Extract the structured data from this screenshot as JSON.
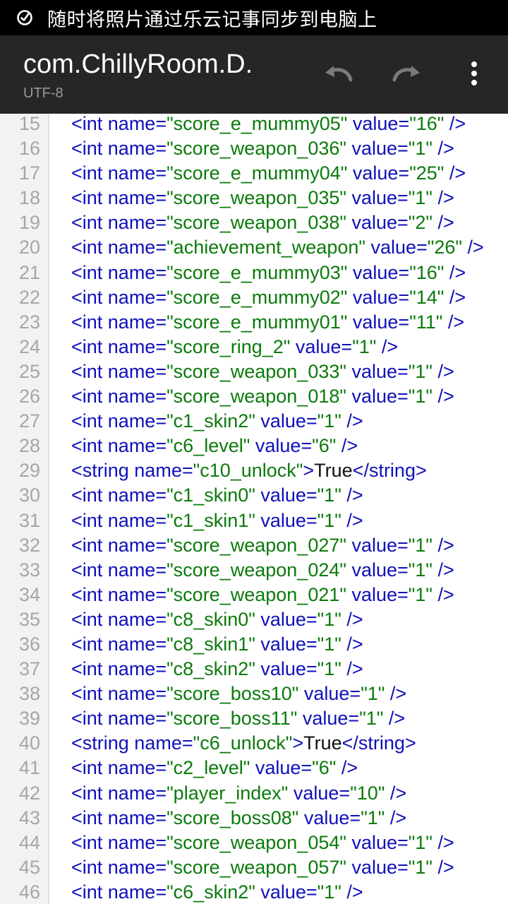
{
  "statusbar": {
    "text": "随时将照片通过乐云记事同步到电脑上",
    "icon": "note-sync-icon"
  },
  "appbar": {
    "title": "com.ChillyRoom.D.",
    "encoding": "UTF-8",
    "actions": [
      "undo-icon",
      "redo-icon",
      "more-vert-icon"
    ]
  },
  "colors": {
    "tag": "#1010bb",
    "value": "#0c7a0c",
    "text": "#111111",
    "line_number": "#a6a6a6",
    "gutter_bg": "#f2f2f2",
    "appbar_bg": "#262626"
  },
  "editor": {
    "lines": [
      {
        "num": "15",
        "parts": [
          {
            "t": "<int name=",
            "c": "tag"
          },
          {
            "t": "\"score_e_mummy05\"",
            "c": "value"
          },
          {
            "t": " value=",
            "c": "tag"
          },
          {
            "t": "\"16\"",
            "c": "value"
          },
          {
            "t": " />",
            "c": "tag"
          }
        ]
      },
      {
        "num": "16",
        "parts": [
          {
            "t": "<int name=",
            "c": "tag"
          },
          {
            "t": "\"score_weapon_036\"",
            "c": "value"
          },
          {
            "t": " value=",
            "c": "tag"
          },
          {
            "t": "\"1\"",
            "c": "value"
          },
          {
            "t": " />",
            "c": "tag"
          }
        ]
      },
      {
        "num": "17",
        "parts": [
          {
            "t": "<int name=",
            "c": "tag"
          },
          {
            "t": "\"score_e_mummy04\"",
            "c": "value"
          },
          {
            "t": " value=",
            "c": "tag"
          },
          {
            "t": "\"25\"",
            "c": "value"
          },
          {
            "t": " />",
            "c": "tag"
          }
        ]
      },
      {
        "num": "18",
        "parts": [
          {
            "t": "<int name=",
            "c": "tag"
          },
          {
            "t": "\"score_weapon_035\"",
            "c": "value"
          },
          {
            "t": " value=",
            "c": "tag"
          },
          {
            "t": "\"1\"",
            "c": "value"
          },
          {
            "t": " />",
            "c": "tag"
          }
        ]
      },
      {
        "num": "19",
        "parts": [
          {
            "t": "<int name=",
            "c": "tag"
          },
          {
            "t": "\"score_weapon_038\"",
            "c": "value"
          },
          {
            "t": " value=",
            "c": "tag"
          },
          {
            "t": "\"2\"",
            "c": "value"
          },
          {
            "t": " />",
            "c": "tag"
          }
        ]
      },
      {
        "num": "20",
        "parts": [
          {
            "t": "<int name=",
            "c": "tag"
          },
          {
            "t": "\"achievement_weapon\"",
            "c": "value"
          },
          {
            "t": " value=",
            "c": "tag"
          },
          {
            "t": "\"26\"",
            "c": "value"
          },
          {
            "t": " />",
            "c": "tag"
          }
        ]
      },
      {
        "num": "21",
        "parts": [
          {
            "t": "<int name=",
            "c": "tag"
          },
          {
            "t": "\"score_e_mummy03\"",
            "c": "value"
          },
          {
            "t": " value=",
            "c": "tag"
          },
          {
            "t": "\"16\"",
            "c": "value"
          },
          {
            "t": " />",
            "c": "tag"
          }
        ]
      },
      {
        "num": "22",
        "parts": [
          {
            "t": "<int name=",
            "c": "tag"
          },
          {
            "t": "\"score_e_mummy02\"",
            "c": "value"
          },
          {
            "t": " value=",
            "c": "tag"
          },
          {
            "t": "\"14\"",
            "c": "value"
          },
          {
            "t": " />",
            "c": "tag"
          }
        ]
      },
      {
        "num": "23",
        "parts": [
          {
            "t": "<int name=",
            "c": "tag"
          },
          {
            "t": "\"score_e_mummy01\"",
            "c": "value"
          },
          {
            "t": " value=",
            "c": "tag"
          },
          {
            "t": "\"11\"",
            "c": "value"
          },
          {
            "t": " />",
            "c": "tag"
          }
        ]
      },
      {
        "num": "24",
        "parts": [
          {
            "t": "<int name=",
            "c": "tag"
          },
          {
            "t": "\"score_ring_2\"",
            "c": "value"
          },
          {
            "t": " value=",
            "c": "tag"
          },
          {
            "t": "\"1\"",
            "c": "value"
          },
          {
            "t": " />",
            "c": "tag"
          }
        ]
      },
      {
        "num": "25",
        "parts": [
          {
            "t": "<int name=",
            "c": "tag"
          },
          {
            "t": "\"score_weapon_033\"",
            "c": "value"
          },
          {
            "t": " value=",
            "c": "tag"
          },
          {
            "t": "\"1\"",
            "c": "value"
          },
          {
            "t": " />",
            "c": "tag"
          }
        ]
      },
      {
        "num": "26",
        "parts": [
          {
            "t": "<int name=",
            "c": "tag"
          },
          {
            "t": "\"score_weapon_018\"",
            "c": "value"
          },
          {
            "t": " value=",
            "c": "tag"
          },
          {
            "t": "\"1\"",
            "c": "value"
          },
          {
            "t": " />",
            "c": "tag"
          }
        ]
      },
      {
        "num": "27",
        "parts": [
          {
            "t": "<int name=",
            "c": "tag"
          },
          {
            "t": "\"c1_skin2\"",
            "c": "value"
          },
          {
            "t": " value=",
            "c": "tag"
          },
          {
            "t": "\"1\"",
            "c": "value"
          },
          {
            "t": " />",
            "c": "tag"
          }
        ]
      },
      {
        "num": "28",
        "parts": [
          {
            "t": "<int name=",
            "c": "tag"
          },
          {
            "t": "\"c6_level\"",
            "c": "value"
          },
          {
            "t": " value=",
            "c": "tag"
          },
          {
            "t": "\"6\"",
            "c": "value"
          },
          {
            "t": " />",
            "c": "tag"
          }
        ]
      },
      {
        "num": "29",
        "parts": [
          {
            "t": "<string name=",
            "c": "tag"
          },
          {
            "t": "\"c10_unlock\"",
            "c": "value"
          },
          {
            "t": ">",
            "c": "tag"
          },
          {
            "t": "True",
            "c": "text"
          },
          {
            "t": "</string>",
            "c": "tag"
          }
        ]
      },
      {
        "num": "30",
        "parts": [
          {
            "t": "<int name=",
            "c": "tag"
          },
          {
            "t": "\"c1_skin0\"",
            "c": "value"
          },
          {
            "t": " value=",
            "c": "tag"
          },
          {
            "t": "\"1\"",
            "c": "value"
          },
          {
            "t": " />",
            "c": "tag"
          }
        ]
      },
      {
        "num": "31",
        "parts": [
          {
            "t": "<int name=",
            "c": "tag"
          },
          {
            "t": "\"c1_skin1\"",
            "c": "value"
          },
          {
            "t": " value=",
            "c": "tag"
          },
          {
            "t": "\"1\"",
            "c": "value"
          },
          {
            "t": " />",
            "c": "tag"
          }
        ]
      },
      {
        "num": "32",
        "parts": [
          {
            "t": "<int name=",
            "c": "tag"
          },
          {
            "t": "\"score_weapon_027\"",
            "c": "value"
          },
          {
            "t": " value=",
            "c": "tag"
          },
          {
            "t": "\"1\"",
            "c": "value"
          },
          {
            "t": " />",
            "c": "tag"
          }
        ]
      },
      {
        "num": "33",
        "parts": [
          {
            "t": "<int name=",
            "c": "tag"
          },
          {
            "t": "\"score_weapon_024\"",
            "c": "value"
          },
          {
            "t": " value=",
            "c": "tag"
          },
          {
            "t": "\"1\"",
            "c": "value"
          },
          {
            "t": " />",
            "c": "tag"
          }
        ]
      },
      {
        "num": "34",
        "parts": [
          {
            "t": "<int name=",
            "c": "tag"
          },
          {
            "t": "\"score_weapon_021\"",
            "c": "value"
          },
          {
            "t": " value=",
            "c": "tag"
          },
          {
            "t": "\"1\"",
            "c": "value"
          },
          {
            "t": " />",
            "c": "tag"
          }
        ]
      },
      {
        "num": "35",
        "parts": [
          {
            "t": "<int name=",
            "c": "tag"
          },
          {
            "t": "\"c8_skin0\"",
            "c": "value"
          },
          {
            "t": " value=",
            "c": "tag"
          },
          {
            "t": "\"1\"",
            "c": "value"
          },
          {
            "t": " />",
            "c": "tag"
          }
        ]
      },
      {
        "num": "36",
        "parts": [
          {
            "t": "<int name=",
            "c": "tag"
          },
          {
            "t": "\"c8_skin1\"",
            "c": "value"
          },
          {
            "t": " value=",
            "c": "tag"
          },
          {
            "t": "\"1\"",
            "c": "value"
          },
          {
            "t": " />",
            "c": "tag"
          }
        ]
      },
      {
        "num": "37",
        "parts": [
          {
            "t": "<int name=",
            "c": "tag"
          },
          {
            "t": "\"c8_skin2\"",
            "c": "value"
          },
          {
            "t": " value=",
            "c": "tag"
          },
          {
            "t": "\"1\"",
            "c": "value"
          },
          {
            "t": " />",
            "c": "tag"
          }
        ]
      },
      {
        "num": "38",
        "parts": [
          {
            "t": "<int name=",
            "c": "tag"
          },
          {
            "t": "\"score_boss10\"",
            "c": "value"
          },
          {
            "t": " value=",
            "c": "tag"
          },
          {
            "t": "\"1\"",
            "c": "value"
          },
          {
            "t": " />",
            "c": "tag"
          }
        ]
      },
      {
        "num": "39",
        "parts": [
          {
            "t": "<int name=",
            "c": "tag"
          },
          {
            "t": "\"score_boss11\"",
            "c": "value"
          },
          {
            "t": " value=",
            "c": "tag"
          },
          {
            "t": "\"1\"",
            "c": "value"
          },
          {
            "t": " />",
            "c": "tag"
          }
        ]
      },
      {
        "num": "40",
        "parts": [
          {
            "t": "<string name=",
            "c": "tag"
          },
          {
            "t": "\"c6_unlock\"",
            "c": "value"
          },
          {
            "t": ">",
            "c": "tag"
          },
          {
            "t": "True",
            "c": "text"
          },
          {
            "t": "</string>",
            "c": "tag"
          }
        ]
      },
      {
        "num": "41",
        "parts": [
          {
            "t": "<int name=",
            "c": "tag"
          },
          {
            "t": "\"c2_level\"",
            "c": "value"
          },
          {
            "t": " value=",
            "c": "tag"
          },
          {
            "t": "\"6\"",
            "c": "value"
          },
          {
            "t": " />",
            "c": "tag"
          }
        ]
      },
      {
        "num": "42",
        "parts": [
          {
            "t": "<int name=",
            "c": "tag"
          },
          {
            "t": "\"player_index\"",
            "c": "value"
          },
          {
            "t": " value=",
            "c": "tag"
          },
          {
            "t": "\"10\"",
            "c": "value"
          },
          {
            "t": " />",
            "c": "tag"
          }
        ]
      },
      {
        "num": "43",
        "parts": [
          {
            "t": "<int name=",
            "c": "tag"
          },
          {
            "t": "\"score_boss08\"",
            "c": "value"
          },
          {
            "t": " value=",
            "c": "tag"
          },
          {
            "t": "\"1\"",
            "c": "value"
          },
          {
            "t": " />",
            "c": "tag"
          }
        ]
      },
      {
        "num": "44",
        "parts": [
          {
            "t": "<int name=",
            "c": "tag"
          },
          {
            "t": "\"score_weapon_054\"",
            "c": "value"
          },
          {
            "t": " value=",
            "c": "tag"
          },
          {
            "t": "\"1\"",
            "c": "value"
          },
          {
            "t": " />",
            "c": "tag"
          }
        ]
      },
      {
        "num": "45",
        "parts": [
          {
            "t": "<int name=",
            "c": "tag"
          },
          {
            "t": "\"score_weapon_057\"",
            "c": "value"
          },
          {
            "t": " value=",
            "c": "tag"
          },
          {
            "t": "\"1\"",
            "c": "value"
          },
          {
            "t": " />",
            "c": "tag"
          }
        ]
      },
      {
        "num": "46",
        "parts": [
          {
            "t": "<int name=",
            "c": "tag"
          },
          {
            "t": "\"c6_skin2\"",
            "c": "value"
          },
          {
            "t": " value=",
            "c": "tag"
          },
          {
            "t": "\"1\"",
            "c": "value"
          },
          {
            "t": " />",
            "c": "tag"
          }
        ]
      }
    ]
  }
}
